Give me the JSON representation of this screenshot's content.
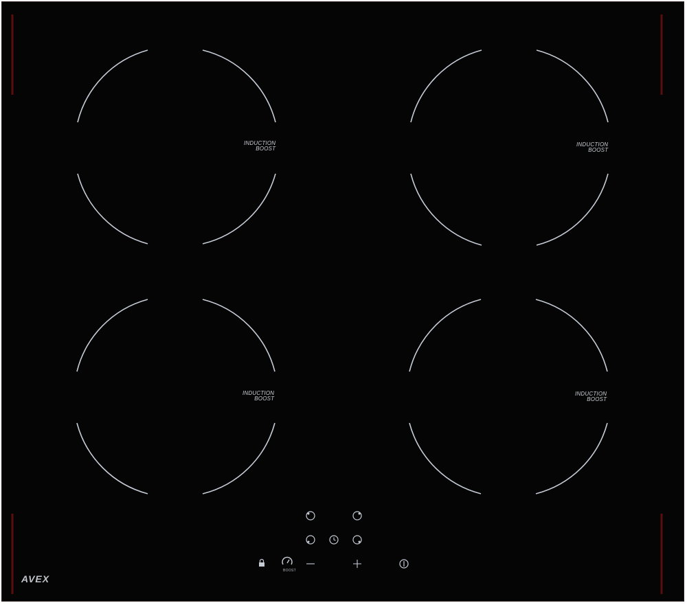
{
  "brand": {
    "name": "AVEX"
  },
  "zones": [
    {
      "id": "front-left-top",
      "line1": "INDUCTION",
      "line2": "BOOST"
    },
    {
      "id": "rear-right",
      "line1": "INDUCTION",
      "line2": "BOOST"
    },
    {
      "id": "front-left",
      "line1": "INDUCTION",
      "line2": "BOOST"
    },
    {
      "id": "front-right",
      "line1": "INDUCTION",
      "line2": "BOOST"
    }
  ],
  "controls": {
    "boost_label": "BOOST",
    "minus_symbol": "—",
    "plus_symbol": "+"
  },
  "colors": {
    "glass": "#050505",
    "zone_lines": "#c6ccd6",
    "edge_trim": "#5a0d0d",
    "text": "#c9cdd3"
  },
  "icons": [
    "zone-select-icon",
    "timer-icon",
    "lock-icon",
    "boost-icon",
    "minus-icon",
    "plus-icon",
    "power-icon"
  ]
}
